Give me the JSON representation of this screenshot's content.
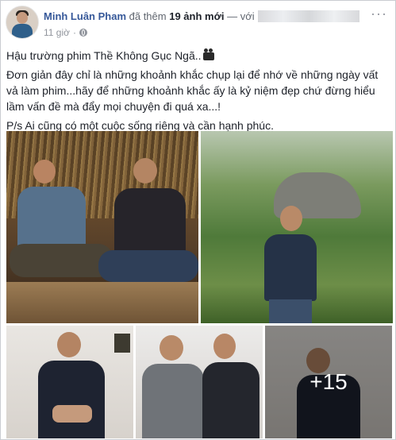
{
  "post": {
    "author": "Minh Luân Pham",
    "action_prefix": "đã thêm",
    "action_count": "19 ảnh mới",
    "action_suffix": "— với",
    "time": "11 giờ",
    "privacy_icon": "globe-icon",
    "menu_icon": "more-options-icon",
    "lines": [
      "Hậu trường phim Thề Không Gục Ngã..",
      "Đơn giản đây chỉ là những khoảnh khắc chụp lại để nhớ về những ngày vất vả làm phim...hãy để những khoảnh khắc ấy là kỷ niệm đẹp chứ đừng hiểu lầm vấn đề mà đẩy mọi chuyện đi quá xa...!",
      "P/s Ai cũng có một cuộc sống riêng và cần hạnh phúc."
    ]
  },
  "photos": {
    "more_count": "+15"
  },
  "colors": {
    "link": "#365899",
    "text": "#1d2129",
    "meta": "#90949c"
  }
}
